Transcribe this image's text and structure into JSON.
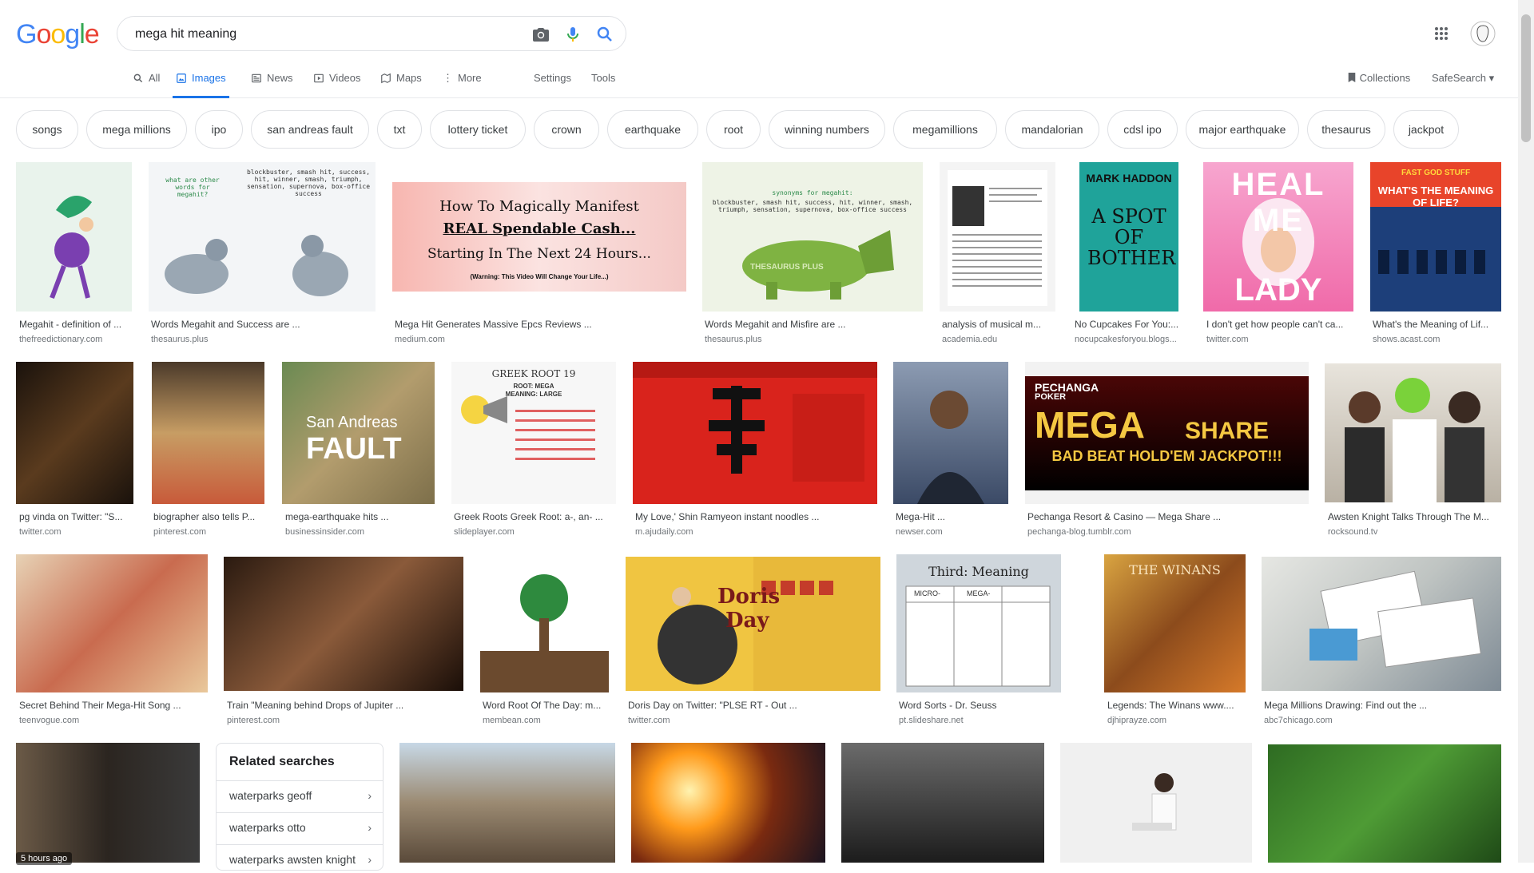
{
  "brand": {
    "logo_letters": [
      "G",
      "o",
      "o",
      "g",
      "l",
      "e"
    ],
    "logo_colors": [
      "#4285f4",
      "#ea4335",
      "#fbbc05",
      "#4285f4",
      "#34a853",
      "#ea4335"
    ]
  },
  "search": {
    "query": "mega hit meaning"
  },
  "tabs": [
    {
      "label": "All",
      "icon": "search-icon"
    },
    {
      "label": "Images",
      "icon": "image-icon"
    },
    {
      "label": "News",
      "icon": "news-icon"
    },
    {
      "label": "Videos",
      "icon": "video-icon"
    },
    {
      "label": "Maps",
      "icon": "map-icon"
    },
    {
      "label": "More",
      "icon": "dots-vertical-icon"
    }
  ],
  "tools": {
    "settings": "Settings",
    "tools": "Tools"
  },
  "right_tools": {
    "collections": "Collections",
    "safesearch": "SafeSearch"
  },
  "chips": [
    "songs",
    "mega millions",
    "ipo",
    "san andreas fault",
    "txt",
    "lottery ticket",
    "crown",
    "earthquake",
    "root",
    "winning numbers",
    "megamillions",
    "mandalorian",
    "cdsl ipo",
    "major earthquake",
    "thesaurus",
    "jackpot"
  ],
  "results": [
    {
      "caption": "Megahit - definition of ...",
      "source": "thefreedictionary.com",
      "color": "#e9f3ec"
    },
    {
      "caption": "Words Megahit and Success are ...",
      "source": "thesaurus.plus",
      "color": "#f3f5f7"
    },
    {
      "caption": "Mega Hit Generates Massive Epcs Reviews ...",
      "source": "medium.com",
      "color": "#f4c9c6"
    },
    {
      "caption": "Words Megahit and Misfire are ...",
      "source": "thesaurus.plus",
      "color": "#eef3e6"
    },
    {
      "caption": "analysis of musical m...",
      "source": "academia.edu",
      "color": "#ededed"
    },
    {
      "caption": "No Cupcakes For You:...",
      "source": "nocupcakesforyou.blogs...",
      "color": "#1fa39a"
    },
    {
      "caption": "I don't get how people can't ca...",
      "source": "twitter.com",
      "color": "#f48ec1"
    },
    {
      "caption": "What's the Meaning of Lif...",
      "source": "shows.acast.com",
      "color": "#1d3f7a"
    },
    {
      "caption": "pg vinda on Twitter: \"S...",
      "source": "twitter.com",
      "color": "#3a2a1b"
    },
    {
      "caption": "biographer also tells P...",
      "source": "pinterest.com",
      "color": "#b08a5c"
    },
    {
      "caption": "mega-earthquake hits ...",
      "source": "businessinsider.com",
      "color": "#8a8760"
    },
    {
      "caption": "Greek Roots Greek Root: a-, an- ...",
      "source": "slideplayer.com",
      "color": "#f5f5f5"
    },
    {
      "caption": "My Love,' Shin Ramyeon instant noodles ...",
      "source": "m.ajudaily.com",
      "color": "#d9231c"
    },
    {
      "caption": "Mega-Hit ...",
      "source": "newser.com",
      "color": "#5a6a86"
    },
    {
      "caption": "Pechanga Resort & Casino — Mega Share ...",
      "source": "pechanga-blog.tumblr.com",
      "color": "#6b0b0b"
    },
    {
      "caption": "Awsten Knight Talks Through The M...",
      "source": "rocksound.tv",
      "color": "#c9c3b8"
    },
    {
      "caption": "Secret Behind Their Mega-Hit Song ...",
      "source": "teenvogue.com",
      "color": "#d7b08c"
    },
    {
      "caption": "Train \"Meaning behind Drops of Jupiter ...",
      "source": "pinterest.com",
      "color": "#5c3f26"
    },
    {
      "caption": "Word Root Of The Day: m...",
      "source": "membean.com",
      "color": "#8b6b46"
    },
    {
      "caption": "Doris Day on Twitter: \"PLSE RT - Out ...",
      "source": "twitter.com",
      "color": "#f0c541"
    },
    {
      "caption": "Word Sorts - Dr. Seuss",
      "source": "pt.slideshare.net",
      "color": "#cfd6dc"
    },
    {
      "caption": "Legends: The Winans www....",
      "source": "djhiprayze.com",
      "color": "#c4572c"
    },
    {
      "caption": "Mega Millions Drawing: Find out the ...",
      "source": "abc7chicago.com",
      "color": "#d5d7d3"
    },
    {
      "caption": "",
      "source": "",
      "color": "#504a45"
    },
    {
      "caption": "",
      "source": "",
      "color": "#a99885"
    },
    {
      "caption": "",
      "source": "",
      "color": "#c24a17"
    },
    {
      "caption": "",
      "source": "",
      "color": "#3a3a3a"
    },
    {
      "caption": "",
      "source": "",
      "color": "#f0f0f0"
    },
    {
      "caption": "",
      "source": "",
      "color": "#3f7d2e"
    }
  ],
  "image_texts": {
    "medium": [
      "How To Magically Manifest",
      "REAL Spendable Cash...",
      "Starting In The Next 24 Hours...",
      "(Warning: This Video Will Change Your Life...)"
    ],
    "haddon": [
      "MARK HADDON",
      "A SPOT OF BOTHER"
    ],
    "gaga": [
      "HEAL ME",
      "LADY GAGA"
    ],
    "acast": [
      "FAST GOD STUFF",
      "WHAT'S THE MEANING OF LIFE?"
    ],
    "greek": [
      "GREEK ROOT 19",
      "ROOT: MEGA",
      "MEANING: LARGE"
    ],
    "sanandreas": [
      "San Andreas",
      "FAULT"
    ],
    "pechanga": [
      "PECHANGA",
      "POKER",
      "MEGA",
      "SHARE",
      "BAD BEAT HOLD'EM JACKPOT!!!"
    ],
    "wordsorts": [
      "Third: Meaning",
      "MICRO-",
      "MEGA-"
    ],
    "doris": [
      "Doris",
      "Day"
    ],
    "winans": [
      "THE WINANS"
    ],
    "thesaurus1": [
      "what are other words for megahit?",
      "blockbuster, smash hit, success, hit, winner, smash, triumph, sensation, supernova, box-office success"
    ],
    "thesaurus2": [
      "synonyms for megahit:",
      "blockbuster, smash hit, success, hit, winner, smash, triumph, sensation, supernova, box-office success",
      "THESAURUS PLUS"
    ]
  },
  "related": {
    "title": "Related searches",
    "items": [
      "waterparks geoff",
      "waterparks otto",
      "waterparks awsten knight"
    ]
  },
  "badge": "5 hours ago"
}
